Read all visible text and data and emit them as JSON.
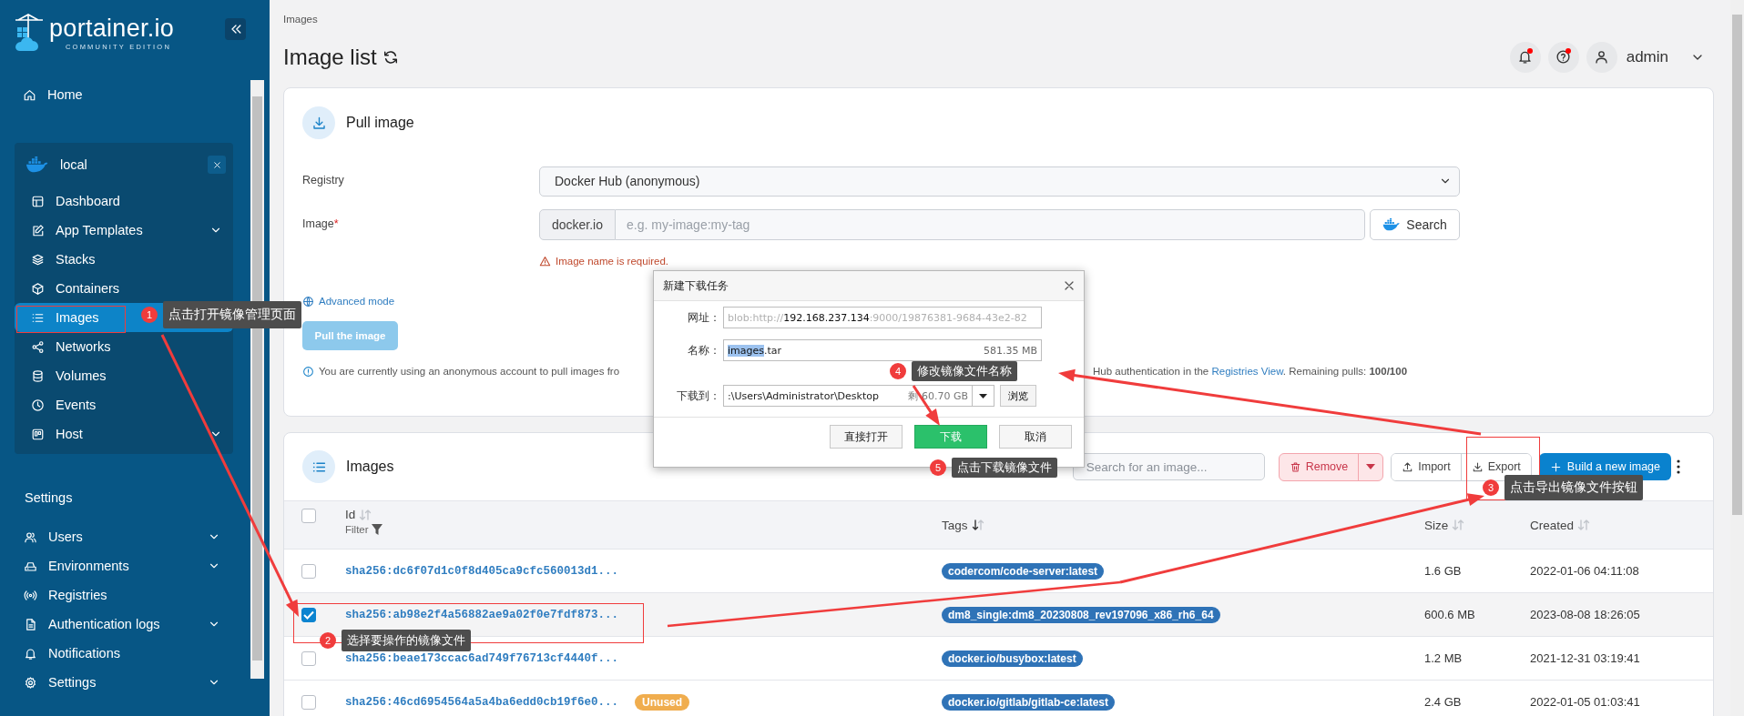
{
  "sidebar": {
    "logo": {
      "name": "portainer.io",
      "edition": "COMMUNITY EDITION"
    },
    "home": {
      "label": "Home",
      "selected": false
    },
    "environment": {
      "name": "local",
      "items": [
        {
          "label": "Dashboard",
          "expandable": false,
          "selected": false
        },
        {
          "label": "App Templates",
          "expandable": true,
          "selected": false
        },
        {
          "label": "Stacks",
          "expandable": false,
          "selected": false
        },
        {
          "label": "Containers",
          "expandable": false,
          "selected": false
        },
        {
          "label": "Images",
          "expandable": false,
          "selected": true
        },
        {
          "label": "Networks",
          "expandable": false,
          "selected": false
        },
        {
          "label": "Volumes",
          "expandable": false,
          "selected": false
        },
        {
          "label": "Events",
          "expandable": false,
          "selected": false
        },
        {
          "label": "Host",
          "expandable": true,
          "selected": false
        }
      ]
    },
    "settings": {
      "title": "Settings",
      "items": [
        {
          "label": "Users",
          "expandable": true,
          "selected": false
        },
        {
          "label": "Environments",
          "expandable": true,
          "selected": false
        },
        {
          "label": "Registries",
          "expandable": false,
          "selected": false
        },
        {
          "label": "Authentication logs",
          "expandable": true,
          "selected": false
        },
        {
          "label": "Notifications",
          "expandable": false,
          "selected": false
        },
        {
          "label": "Settings",
          "expandable": true,
          "selected": false
        }
      ]
    }
  },
  "header": {
    "breadcrumb": "Images",
    "title": "Image list",
    "notifications_unread": true,
    "help_unread": true,
    "user": "admin"
  },
  "pull_image": {
    "title": "Pull image",
    "registry_label": "Registry",
    "registry_value": "Docker Hub (anonymous)",
    "image_label": "Image",
    "required_mark": "*",
    "image_prefix": "docker.io",
    "image_placeholder": "e.g. my-image:my-tag",
    "search_button": "Search",
    "error": "Image name is required.",
    "advanced_link": "Advanced mode",
    "pull_button": {
      "label": "Pull the image",
      "disabled": true
    },
    "info_left": "You are currently using an anonymous account to pull images fro",
    "info_right": {
      "text": "Hub authentication in the ",
      "link": "Registries View",
      "after": ". Remaining pulls: **100/100**"
    }
  },
  "download_dialog": {
    "title": "新建下载任务",
    "url_label": "网址：",
    "url_scheme": "blob:http://",
    "url_host": "192.168.237.134",
    "url_rest": ":9000/19876381-9684-43e2-82",
    "name_label": "名称：",
    "name_selected": "images",
    "name_rest": ".tar",
    "size": "581.35 MB",
    "save_label": "下载到：",
    "save_path": ":\\Users\\Administrator\\Desktop",
    "free_space": "剩 60.70 GB",
    "browse_button": "浏览",
    "buttons": [
      {
        "label": "直接打开",
        "primary": false
      },
      {
        "label": "下载",
        "primary": true
      },
      {
        "label": "取消",
        "primary": false
      }
    ]
  },
  "images": {
    "title": "Images",
    "search_placeholder": "Search for an image...",
    "remove_button": "Remove",
    "import_button": "Import",
    "export_button": "Export",
    "build_button": "Build a new image",
    "select_all_checked": false,
    "columns": [
      {
        "label": "Id",
        "sorted": false,
        "filter": "Filter"
      },
      {
        "label": "Tags",
        "sorted": true
      },
      {
        "label": "Size",
        "sorted": false
      },
      {
        "label": "Created",
        "sorted": false
      }
    ],
    "rows": [
      {
        "id": "sha256:dc6f07d1c0f8d405ca9cfc560013d1...",
        "tags": [
          "codercom/code-server:latest"
        ],
        "size": "1.6 GB",
        "created": "2022-01-06 04:11:08",
        "checked": false
      },
      {
        "id": "sha256:ab98e2f4a56882ae9a02f0e7fdf873...",
        "tags": [
          "dm8_single:dm8_20230808_rev197096_x86_rh6_64"
        ],
        "size": "600.6 MB",
        "created": "2023-08-08 18:26:05",
        "checked": true
      },
      {
        "id": "sha256:beae173ccac6ad749f76713cf4440f...",
        "tags": [
          "docker.io/busybox:latest"
        ],
        "size": "1.2 MB",
        "created": "2021-12-31 03:19:41",
        "checked": false
      },
      {
        "id": "sha256:46cd6954564a5a4ba6edd0cb19f6e0...",
        "badge": "Unused",
        "tags": [
          "docker.io/gitlab/gitlab-ce:latest"
        ],
        "size": "2.4 GB",
        "created": "2022-01-05 01:03:41",
        "checked": false
      }
    ]
  },
  "annotations": [
    {
      "number": "1",
      "text": "点击打开镜像管理页面"
    },
    {
      "number": "2",
      "text": "选择要操作的镜像文件"
    },
    {
      "number": "3",
      "text": "点击导出镜像文件按钮"
    },
    {
      "number": "4",
      "text": "修改镜像文件名称"
    },
    {
      "number": "5",
      "text": "点击下载镜像文件"
    }
  ]
}
